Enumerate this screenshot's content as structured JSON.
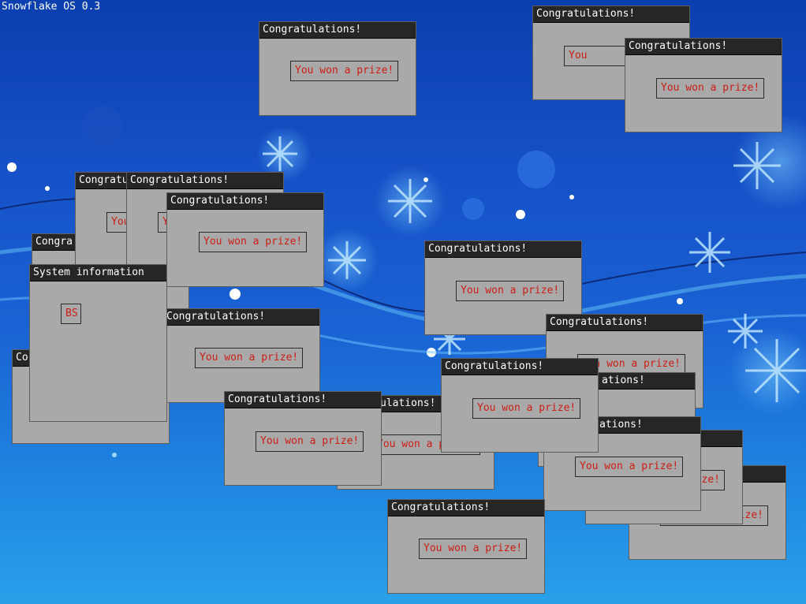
{
  "os": {
    "title": "Snowflake OS 0.3"
  },
  "dialog": {
    "title": "Congratulations!",
    "message": "You won a prize!",
    "partial_title_a": "Congra",
    "partial_title_b": "Co",
    "partial_message_a": "You",
    "partial_message_b": "Y",
    "partial_message_c": "You won a",
    "partial_message_d": "You won a p",
    "partial_message_e": "n won a prize!",
    "partial_message_f": "ze!",
    "partial_message_g": "ize!",
    "partial_title_c": "ulations!",
    "partial_title_d": "ations!"
  },
  "sysinfo": {
    "title": "System information",
    "button_label": "BS"
  },
  "colors": {
    "titlebar": "#262626",
    "window": "#a9a9a9",
    "button_text": "#cc1d14",
    "desktop": "#1652c8"
  }
}
